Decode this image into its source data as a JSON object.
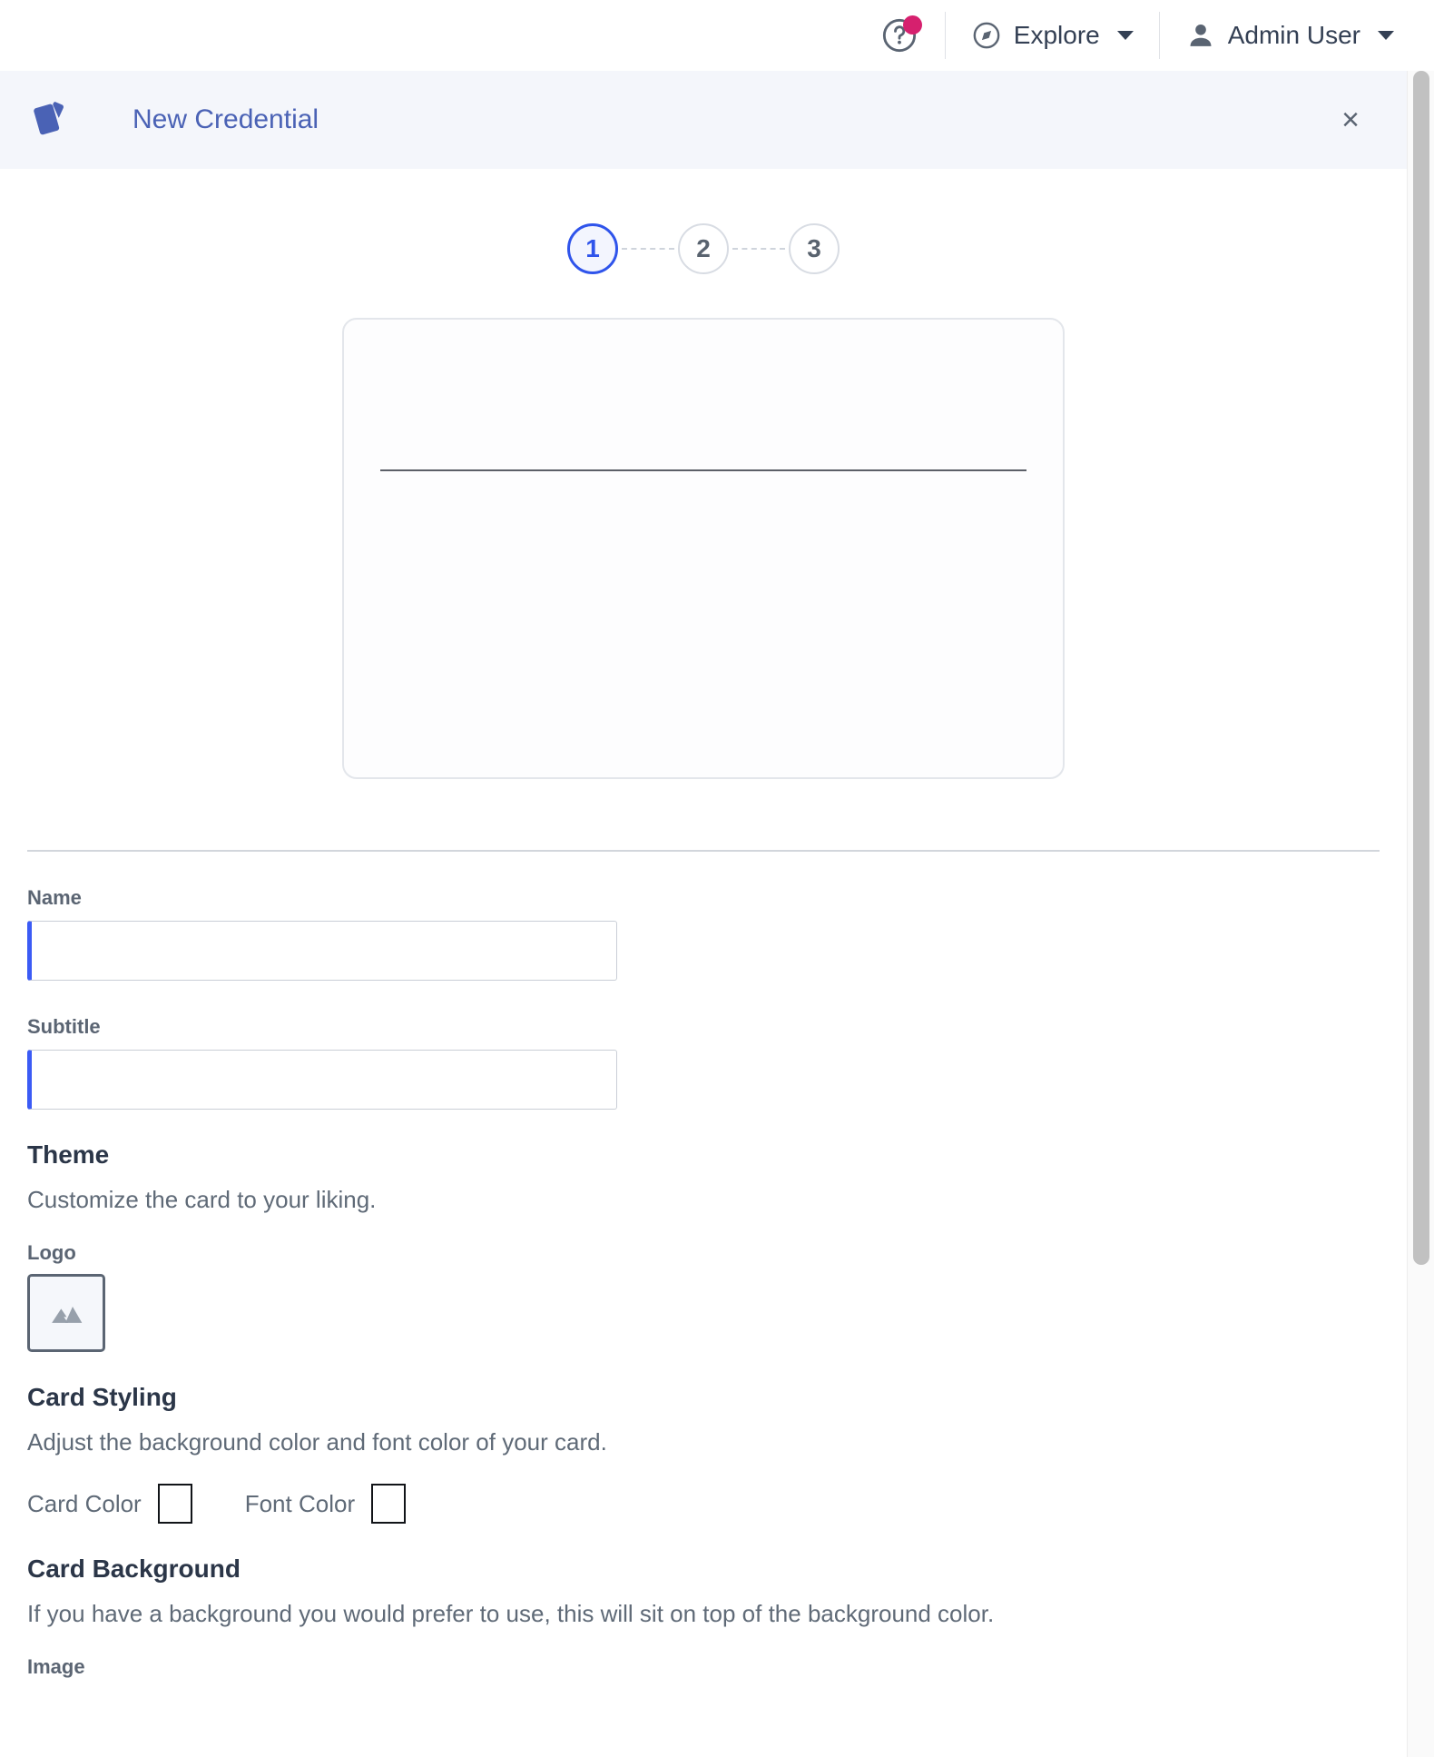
{
  "topnav": {
    "help_icon": "help-circle-icon",
    "help_badge_color": "#d6206e",
    "explore": {
      "label": "Explore",
      "icon": "compass-icon"
    },
    "user": {
      "label": "Admin User",
      "icon": "person-icon"
    }
  },
  "modal": {
    "logo_icon": "card-stack-icon",
    "title": "New Credential",
    "close_label": "×",
    "title_color": "#4a62b5",
    "header_bg": "#f4f6fb"
  },
  "stepper": {
    "steps": [
      {
        "number": "1",
        "state": "active"
      },
      {
        "number": "2",
        "state": "inactive"
      },
      {
        "number": "3",
        "state": "inactive"
      }
    ],
    "active_color": "#2f54eb"
  },
  "preview": {
    "name": "card-preview",
    "divider": true
  },
  "form": {
    "name": {
      "label": "Name",
      "value": "",
      "placeholder": ""
    },
    "subtitle": {
      "label": "Subtitle",
      "value": "",
      "placeholder": ""
    }
  },
  "theme": {
    "title": "Theme",
    "description": "Customize the card to your liking.",
    "logo": {
      "label": "Logo",
      "icon": "image-placeholder-icon"
    }
  },
  "card_styling": {
    "title": "Card Styling",
    "description": "Adjust the background color and font color of your card.",
    "card_color": {
      "label": "Card Color",
      "value": "#ffffff"
    },
    "font_color": {
      "label": "Font Color",
      "value": "#ffffff"
    }
  },
  "card_background": {
    "title": "Card Background",
    "description": "If you have a background you would prefer to use, this will sit on top of the background color.",
    "image_label": "Image"
  }
}
